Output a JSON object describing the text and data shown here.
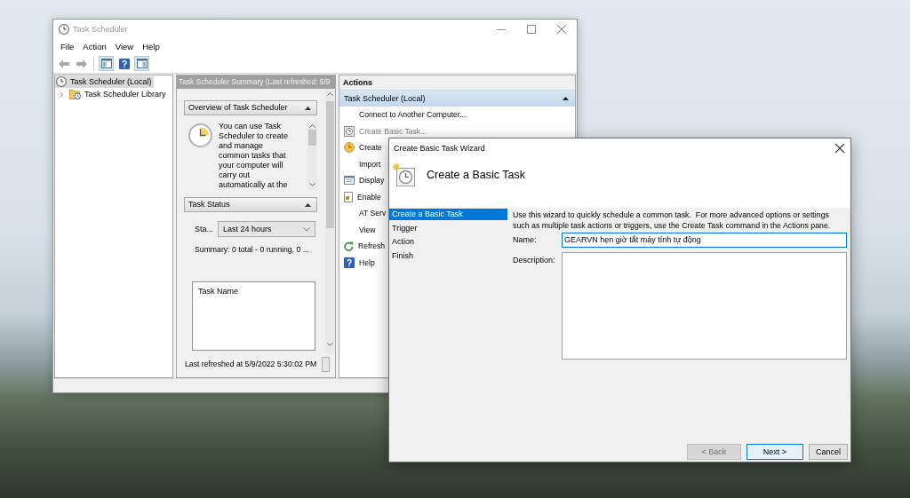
{
  "task_scheduler": {
    "window": {
      "title": "Task Scheduler",
      "active": false
    },
    "menu": [
      "File",
      "Action",
      "View",
      "Help"
    ],
    "toolbar": {
      "navigation": [
        {
          "kind": "back",
          "disabled": true
        },
        {
          "kind": "forward",
          "disabled": true
        }
      ],
      "view": [
        {
          "kind": "console-tree",
          "pressed": true
        },
        {
          "kind": "help",
          "pressed": false
        },
        {
          "kind": "action-pane",
          "pressed": true
        }
      ]
    },
    "tree": [
      {
        "label": "Task Scheduler (Local)",
        "selected": true,
        "children": [
          {
            "label": "Task Scheduler Library",
            "selected": false,
            "expanded": false
          }
        ]
      }
    ],
    "summary": {
      "title": "Task Scheduler Summary (Last refreshed: 5/9",
      "sections": [
        {
          "kind": "overview",
          "title": "Overview of Task Scheduler",
          "expanded": true,
          "text": "You can use Task Scheduler to create and manage common tasks that your computer will carry out automatically at the"
        },
        {
          "kind": "status",
          "title": "Task Status",
          "expanded": true,
          "filter_label": "Sta...",
          "filter_value": "Last 24 hours",
          "summary": "Summary: 0 total - 0 running, 0 ...",
          "list_header": "Task Name"
        }
      ],
      "last_refreshed": "Last refreshed at 5/9/2022 5:30:02 PM"
    },
    "actions": {
      "title": "Actions",
      "sections": [
        {
          "title": "Task Scheduler (Local)",
          "expanded": true,
          "items": [
            {
              "kind": "plain",
              "label": "Connect to Another Computer...",
              "disabled": false
            },
            {
              "kind": "basic-task",
              "label": "Create Basic Task...",
              "disabled": true
            },
            {
              "kind": "task",
              "label": "Create",
              "disabled": false
            },
            {
              "kind": "plain",
              "label": "Import",
              "disabled": false
            },
            {
              "kind": "display",
              "label": "Display",
              "disabled": false
            },
            {
              "kind": "enable",
              "label": "Enable",
              "disabled": false
            },
            {
              "kind": "plain",
              "label": "AT Serv",
              "disabled": false
            },
            {
              "kind": "plain",
              "label": "View",
              "disabled": false
            },
            {
              "kind": "refresh",
              "label": "Refresh",
              "disabled": false
            },
            {
              "kind": "help",
              "label": "Help",
              "disabled": false
            }
          ]
        }
      ]
    }
  },
  "wizard": {
    "window": {
      "title": "Create Basic Task Wizard",
      "active": true
    },
    "heading": "Create a Basic Task",
    "steps": [
      {
        "label": "Create a Basic Task",
        "selected": true
      },
      {
        "label": "Trigger",
        "selected": false
      },
      {
        "label": "Action",
        "selected": false
      },
      {
        "label": "Finish",
        "selected": false
      }
    ],
    "intro": "Use this wizard to quickly schedule a common task.  For more advanced options or settings such as multiple task actions or triggers, use the Create Task command in the Actions pane.",
    "fields": [
      {
        "kind": "line",
        "label": "Name:",
        "value": "GEARVN hẹn giờ tắt máy tính tự động",
        "focused": true
      },
      {
        "kind": "area",
        "label": "Description:",
        "focused": false
      }
    ],
    "buttons": [
      {
        "label": "< Back",
        "disabled": true,
        "default": false
      },
      {
        "label": "Next >",
        "disabled": false,
        "default": true
      },
      {
        "label": "Cancel",
        "disabled": false,
        "default": false
      }
    ]
  }
}
